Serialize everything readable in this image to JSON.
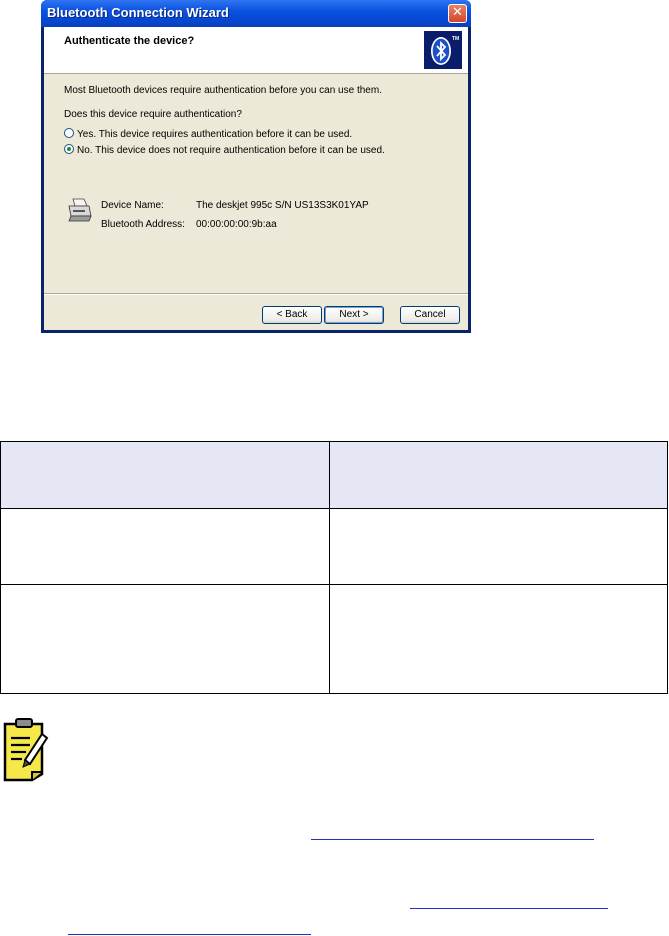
{
  "window": {
    "title": "Bluetooth Connection Wizard",
    "close_glyph": "✕",
    "header_title": "Authenticate the device?",
    "logo": "bluetooth-logo",
    "logo_tm": "TM"
  },
  "content": {
    "intro": "Most Bluetooth devices require authentication before you can use them.",
    "question": "Does this device require authentication?",
    "options": [
      {
        "label": "Yes. This device requires authentication before it can be used.",
        "selected": false
      },
      {
        "label": "No. This device does not require authentication before it can be used.",
        "selected": true
      }
    ],
    "device": {
      "name_label": "Device Name:",
      "name_value": "The deskjet 995c S/N US13S3K01YAP",
      "address_label": "Bluetooth Address:",
      "address_value": "00:00:00:00:9b:aa"
    }
  },
  "buttons": {
    "back": "< Back",
    "next": "Next >",
    "cancel": "Cancel"
  },
  "table": {
    "header": [
      "",
      ""
    ],
    "rows": [
      [
        "",
        ""
      ],
      [
        "",
        ""
      ]
    ]
  },
  "note": {
    "icon": "notepad-pencil-icon",
    "links": [
      "",
      "",
      ""
    ]
  },
  "colors": {
    "titlebar": "#0a52df",
    "dialog_bg": "#ece9d8",
    "table_header_bg": "#e6e7f5",
    "link": "#1f2fc8"
  }
}
